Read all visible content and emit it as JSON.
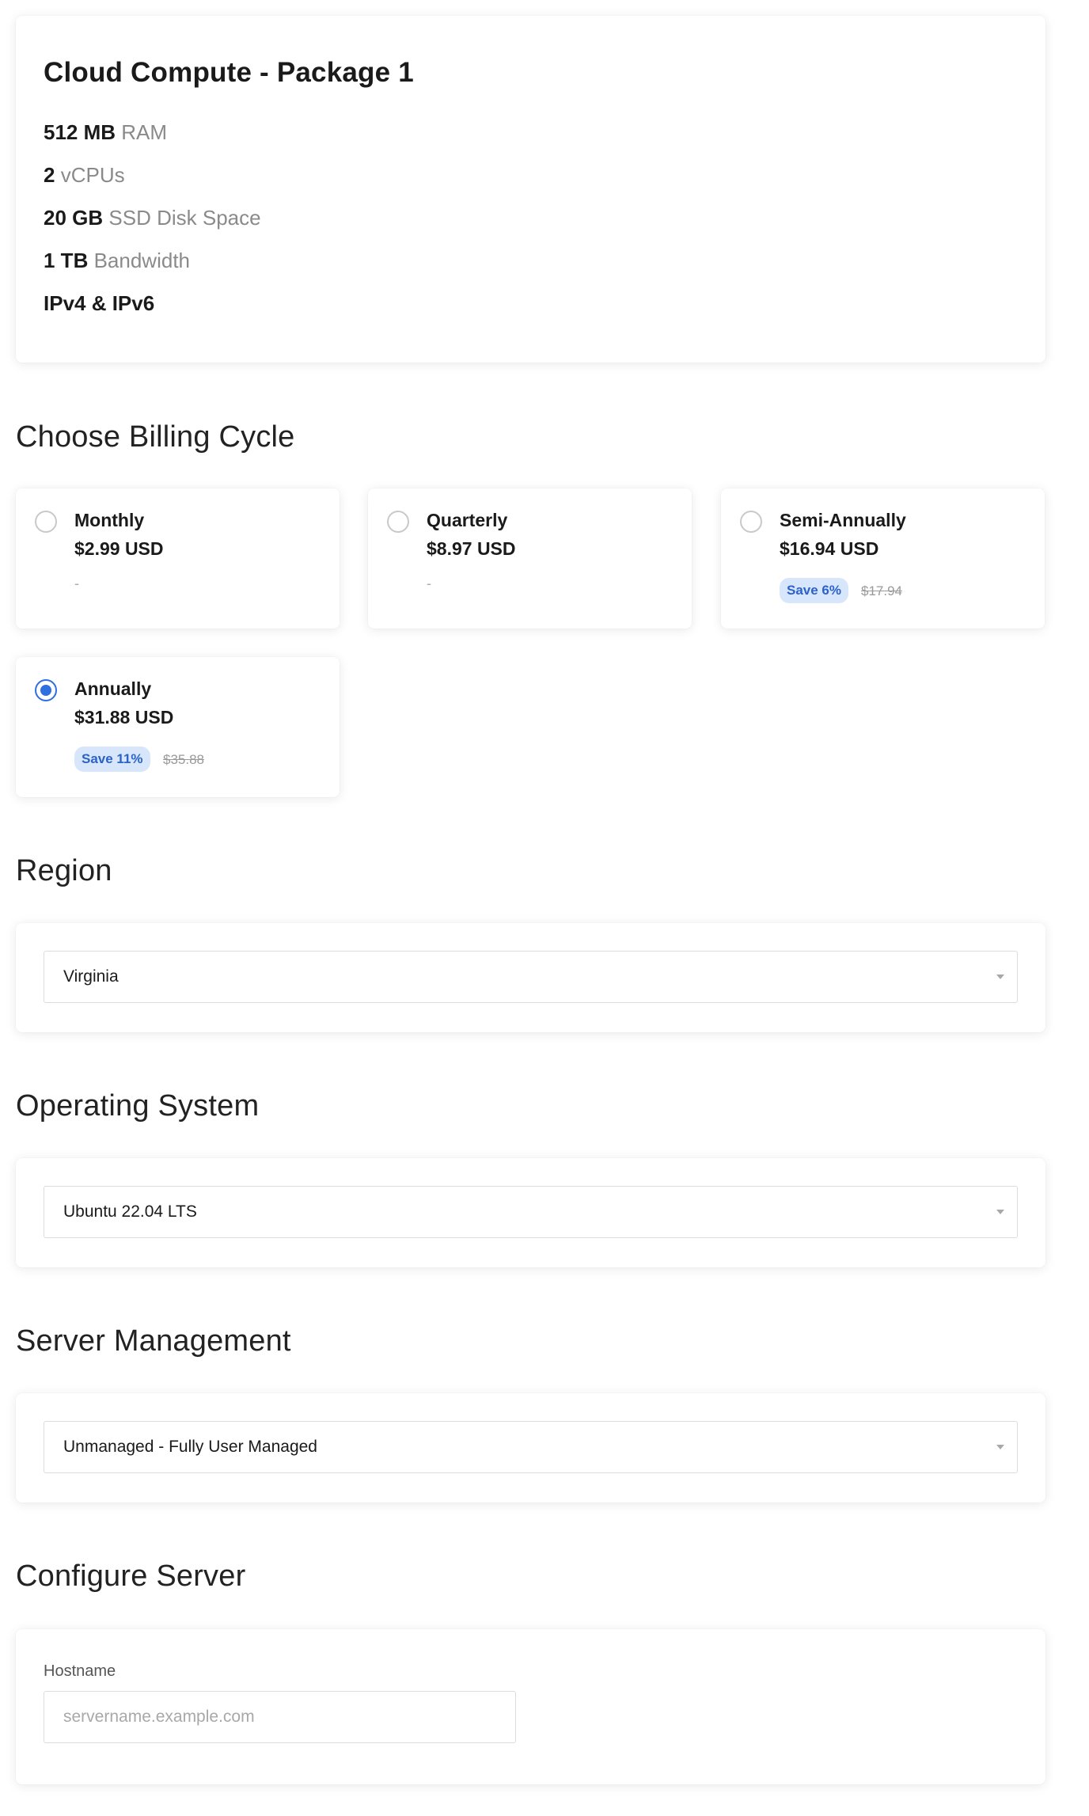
{
  "package": {
    "title": "Cloud Compute - Package 1",
    "specs": [
      {
        "value": "512 MB",
        "label": "RAM"
      },
      {
        "value": "2",
        "label": "vCPUs"
      },
      {
        "value": "20 GB",
        "label": "SSD Disk Space"
      },
      {
        "value": "1 TB",
        "label": "Bandwidth"
      },
      {
        "value": "IPv4 & IPv6",
        "label": ""
      }
    ]
  },
  "billing": {
    "title": "Choose Billing Cycle",
    "selected": "Annually",
    "accent_color": "#2f6fe0",
    "options": [
      {
        "name": "Monthly",
        "price": "$2.99 USD",
        "note": "-",
        "save": "",
        "original": ""
      },
      {
        "name": "Quarterly",
        "price": "$8.97 USD",
        "note": "-",
        "save": "",
        "original": ""
      },
      {
        "name": "Semi-Annually",
        "price": "$16.94 USD",
        "note": "",
        "save": "Save 6%",
        "original": "$17.94"
      },
      {
        "name": "Annually",
        "price": "$31.88 USD",
        "note": "",
        "save": "Save 11%",
        "original": "$35.88"
      }
    ]
  },
  "region": {
    "title": "Region",
    "value": "Virginia"
  },
  "os": {
    "title": "Operating System",
    "value": "Ubuntu 22.04 LTS"
  },
  "management": {
    "title": "Server Management",
    "value": "Unmanaged - Fully User Managed"
  },
  "configure": {
    "title": "Configure Server",
    "hostname_label": "Hostname",
    "hostname_placeholder": "servername.example.com",
    "hostname_value": ""
  }
}
